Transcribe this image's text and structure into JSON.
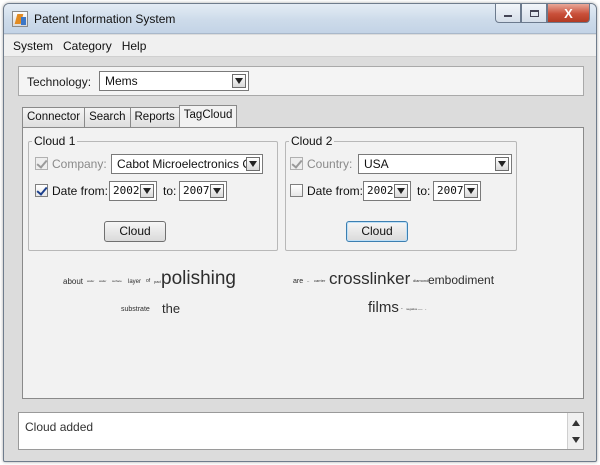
{
  "window": {
    "title": "Patent Information System",
    "controls": {
      "minimize": "minimize",
      "maximize": "maximize",
      "close": "X"
    }
  },
  "menu": [
    "System",
    "Category",
    "Help"
  ],
  "technology": {
    "label": "Technology:",
    "value": "Mems"
  },
  "tabs": [
    {
      "label": "Connector",
      "active": false
    },
    {
      "label": "Search",
      "active": false
    },
    {
      "label": "Reports",
      "active": false
    },
    {
      "label": "TagCloud",
      "active": true
    }
  ],
  "cloud1": {
    "title": "Cloud 1",
    "filter_label": "Company:",
    "filter_checked": true,
    "filter_enabled": false,
    "filter_value": "Cabot Microelectronics Co...",
    "date_checked": true,
    "date_from_label": "Date from:",
    "date_from": "2002",
    "to_label": "to:",
    "date_to": "2007",
    "button": "Cloud",
    "tags": {
      "about": "about",
      "polishing": "polishing",
      "substrate": "substrate",
      "the": "the",
      "layer": "layer",
      "of": "of",
      "pad": "pad",
      "small1": "wafer",
      "small2": "wafer",
      "small3": "surface"
    }
  },
  "cloud2": {
    "title": "Cloud 2",
    "filter_label": "Country:",
    "filter_checked": true,
    "filter_enabled": false,
    "filter_value": "USA",
    "date_checked": false,
    "date_from_label": "Date from:",
    "date_from": "2002",
    "to_label": "to:",
    "date_to": "2007",
    "button": "Cloud",
    "tags": {
      "are": "are",
      "crosslinker": "crosslinker",
      "embodiment": "embodiment",
      "films": "films",
      "small1": "–",
      "small2": "carrier",
      "small3": "diamond",
      "small4": "-",
      "small5": "negative",
      "small6": "––",
      "small7": "-"
    }
  },
  "status": {
    "text": "Cloud added"
  },
  "icons": {
    "app": "app-icon",
    "dropdown": "chevron-down-icon",
    "scroll_up": "scroll-up-arrow-icon",
    "scroll_down": "scroll-down-arrow-icon"
  }
}
